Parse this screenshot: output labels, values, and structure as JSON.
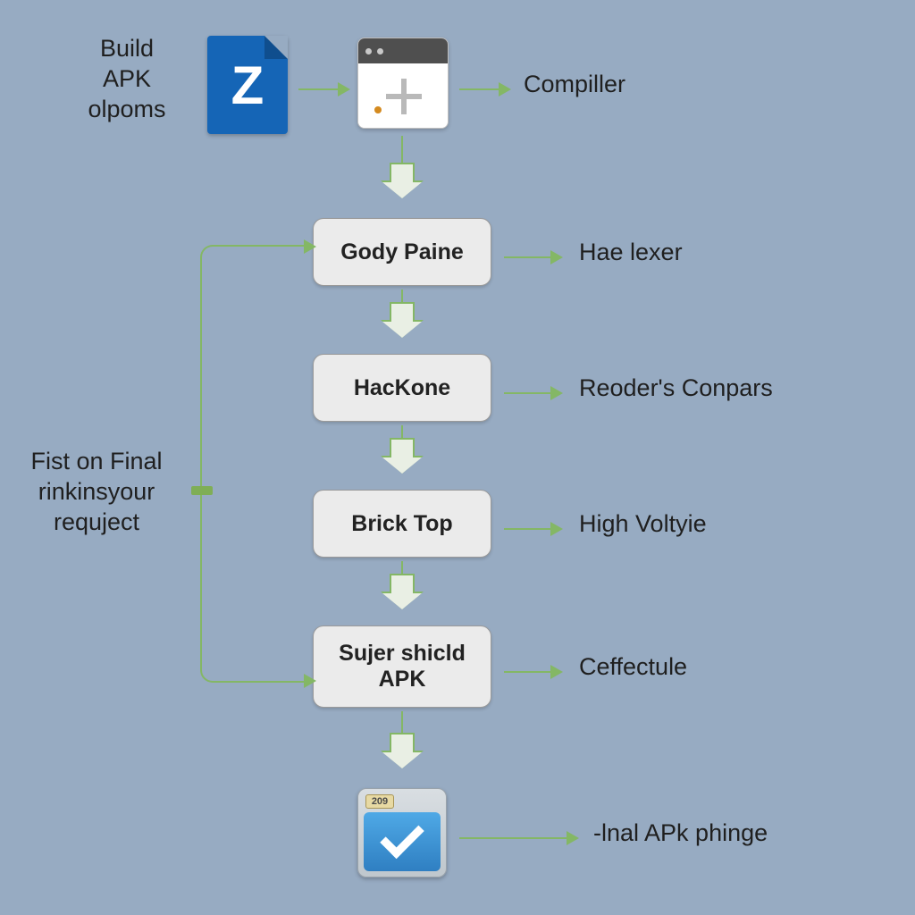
{
  "top_left_label": "Build\nAPK\nolpoms",
  "z_icon_letter": "Z",
  "compiler_label": "Compiller",
  "steps": [
    {
      "title": "Gody Paine",
      "right_label": "Hae lexer"
    },
    {
      "title": "HacKone",
      "right_label": "Reoder's Conpars"
    },
    {
      "title": "Brick Top",
      "right_label": "High Voltyie"
    },
    {
      "title": "Sujer shicld\nAPK",
      "right_label": "Ceffectule"
    }
  ],
  "left_side_label": "Fist on Final\nrinkinsyour\nrequject",
  "final_label": "-lnal APk phinge",
  "check_tab_text": "209"
}
